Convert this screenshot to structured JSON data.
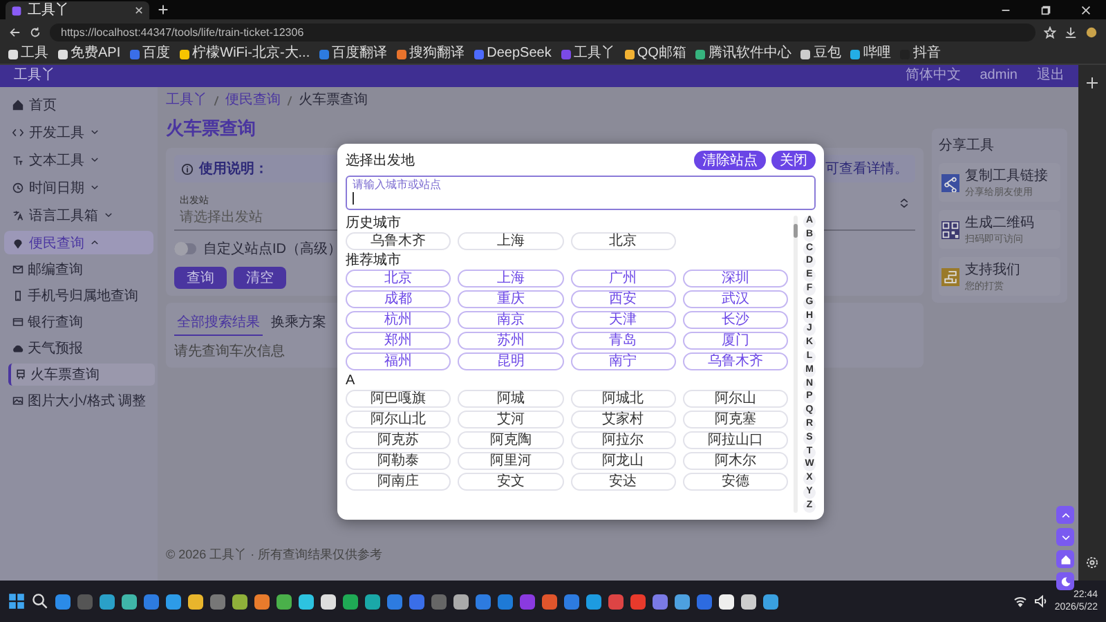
{
  "browser": {
    "tab_title": "工具丫",
    "url": "https://localhost:44347/tools/life/train-ticket-12306",
    "bookmarks": [
      "工具",
      "免费API",
      "百度",
      "柠檬WiFi-北京-大...",
      "百度翻译",
      "搜狗翻译",
      "DeepSeek",
      "工具丫",
      "QQ邮箱",
      "腾讯软件中心",
      "豆包",
      "哔哩",
      "抖音"
    ]
  },
  "app_header": {
    "brand": "工具丫",
    "language": "简体中文",
    "user": "admin",
    "logout": "退出"
  },
  "sidebar": {
    "items": [
      {
        "label": "首页",
        "selected": false
      },
      {
        "label": "开发工具",
        "selected": false,
        "expanded": false
      },
      {
        "label": "文本工具",
        "selected": false,
        "expanded": false
      },
      {
        "label": "时间日期",
        "selected": false,
        "expanded": false
      },
      {
        "label": "语言工具箱",
        "selected": false,
        "expanded": false
      },
      {
        "label": "便民查询",
        "selected": true,
        "expanded": true,
        "children": [
          {
            "label": "邮编查询",
            "selected": false
          },
          {
            "label": "手机号归属地查询",
            "selected": false
          },
          {
            "label": "银行查询",
            "selected": false
          },
          {
            "label": "天气预报",
            "selected": false
          },
          {
            "label": "火车票查询",
            "selected": true
          },
          {
            "label": "图片大小/格式 调整",
            "selected": false
          }
        ]
      }
    ]
  },
  "breadcrumb": [
    "工具丫",
    "便民查询",
    "火车票查询"
  ],
  "page_title": "火车票查询",
  "notice": {
    "label": "使用说明：",
    "tail": "可查看详情。"
  },
  "form": {
    "field_label": "出发站",
    "placeholder": "请选择出发站",
    "toggle": {
      "label": "自定义站点ID（高级）",
      "on": false
    },
    "buttons": [
      "查询",
      "清空"
    ]
  },
  "result_tabs": [
    {
      "label": "全部搜索结果",
      "selected": true
    },
    {
      "label": "换乘方案",
      "selected": false
    }
  ],
  "result_hint": "请先查询车次信息",
  "share_panel": {
    "title": "分享工具",
    "items": [
      {
        "title": "复制工具链接",
        "subtitle": "分享给朋友使用",
        "color": "#3b4fa0"
      },
      {
        "title": "生成二维码",
        "subtitle": "扫码即可访问",
        "color": "#3d3a70"
      },
      {
        "title": "支持我们",
        "subtitle": "您的打赏",
        "color": "#9a7a2a"
      }
    ]
  },
  "footer": "© 2026 工具丫 · 所有查询结果仅供参考",
  "dialog": {
    "title": "选择出发地",
    "buttons": [
      "清除站点",
      "关闭"
    ],
    "search_label": "请输入城市或站点",
    "sections": [
      {
        "heading": "历史城市",
        "highlighted": false,
        "cities": [
          "乌鲁木齐",
          "上海",
          "北京"
        ]
      },
      {
        "heading": "推荐城市",
        "highlighted": true,
        "cities": [
          "北京",
          "上海",
          "广州",
          "深圳",
          "成都",
          "重庆",
          "西安",
          "武汉",
          "杭州",
          "南京",
          "天津",
          "长沙",
          "郑州",
          "苏州",
          "青岛",
          "厦门",
          "福州",
          "昆明",
          "南宁",
          "乌鲁木齐"
        ]
      },
      {
        "heading": "A",
        "highlighted": false,
        "cities": [
          "阿巴嘎旗",
          "阿城",
          "阿城北",
          "阿尔山",
          "阿尔山北",
          "艾河",
          "艾家村",
          "阿克塞",
          "阿克苏",
          "阿克陶",
          "阿拉尔",
          "阿拉山口",
          "阿勒泰",
          "阿里河",
          "阿龙山",
          "阿木尔",
          "阿南庄",
          "安文",
          "安达",
          "安德"
        ]
      }
    ],
    "letters": [
      "A",
      "B",
      "C",
      "D",
      "E",
      "F",
      "G",
      "H",
      "J",
      "K",
      "L",
      "M",
      "N",
      "P",
      "Q",
      "R",
      "S",
      "T",
      "W",
      "X",
      "Y",
      "Z"
    ]
  },
  "taskbar": {
    "time": "22:44",
    "date": "2026/5/22"
  }
}
